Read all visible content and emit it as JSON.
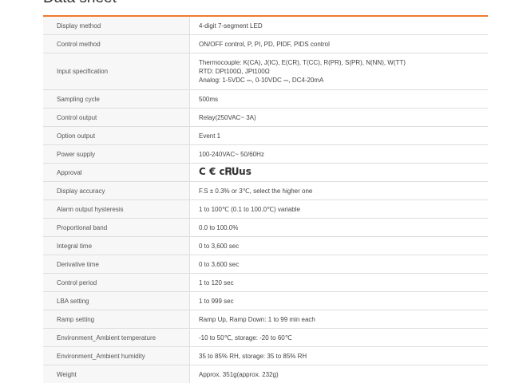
{
  "section": {
    "title": "Data sheet"
  },
  "rows": [
    {
      "label": "Display method",
      "value": "4-digit 7-segment LED"
    },
    {
      "label": "Control method",
      "value": "ON/OFF control, P, PI, PD, PIDF, PIDS control"
    },
    {
      "label": "Input specification",
      "lines": [
        "Thermocouple: K(CA), J(IC), E(CR), T(CC), R(PR), S(PR), N(NN), W(TT)",
        "RTD: DPt100Ω, JPt100Ω",
        "Analog: 1-5VDC ⎓, 0-10VDC ⎓, DC4-20mA"
      ]
    },
    {
      "label": "Sampling cycle",
      "value": "500ms"
    },
    {
      "label": "Control output",
      "value": "Relay(250VAC~ 3A)"
    },
    {
      "label": "Option output",
      "value": "Event 1"
    },
    {
      "label": "Power supply",
      "value": "100-240VAC~ 50/60Hz"
    },
    {
      "label": "Approval",
      "value": "C € c𝐑𝐔us"
    },
    {
      "label": "Display accuracy",
      "value": "F.S ± 0.3% or 3℃, select the higher one"
    },
    {
      "label": "Alarm output hysteresis",
      "value": "1 to 100℃ (0.1 to 100.0℃) variable"
    },
    {
      "label": "Proportional band",
      "value": "0.0 to 100.0%"
    },
    {
      "label": "Integral time",
      "value": "0 to 3,600 sec"
    },
    {
      "label": "Derivative time",
      "value": "0 to 3,600 sec"
    },
    {
      "label": "Control period",
      "value": "1 to 120 sec"
    },
    {
      "label": "LBA setting",
      "value": "1 to 999 sec"
    },
    {
      "label": "Ramp setting",
      "value": "Ramp Up, Ramp Down: 1 to 99 min each"
    },
    {
      "label": "Environment_Ambient temperature",
      "value": "-10 to 50℃, storage: -20 to 60℃"
    },
    {
      "label": "Environment_Ambient humidity",
      "value": "35 to 85% RH, storage: 35 to 85% RH"
    },
    {
      "label": "Weight",
      "value": "Approx. 351g(approx. 232g)"
    }
  ],
  "colors": {
    "accent_rule": "#ee7b2c",
    "label_background": "#f7f7f7",
    "border": "#dedede"
  }
}
